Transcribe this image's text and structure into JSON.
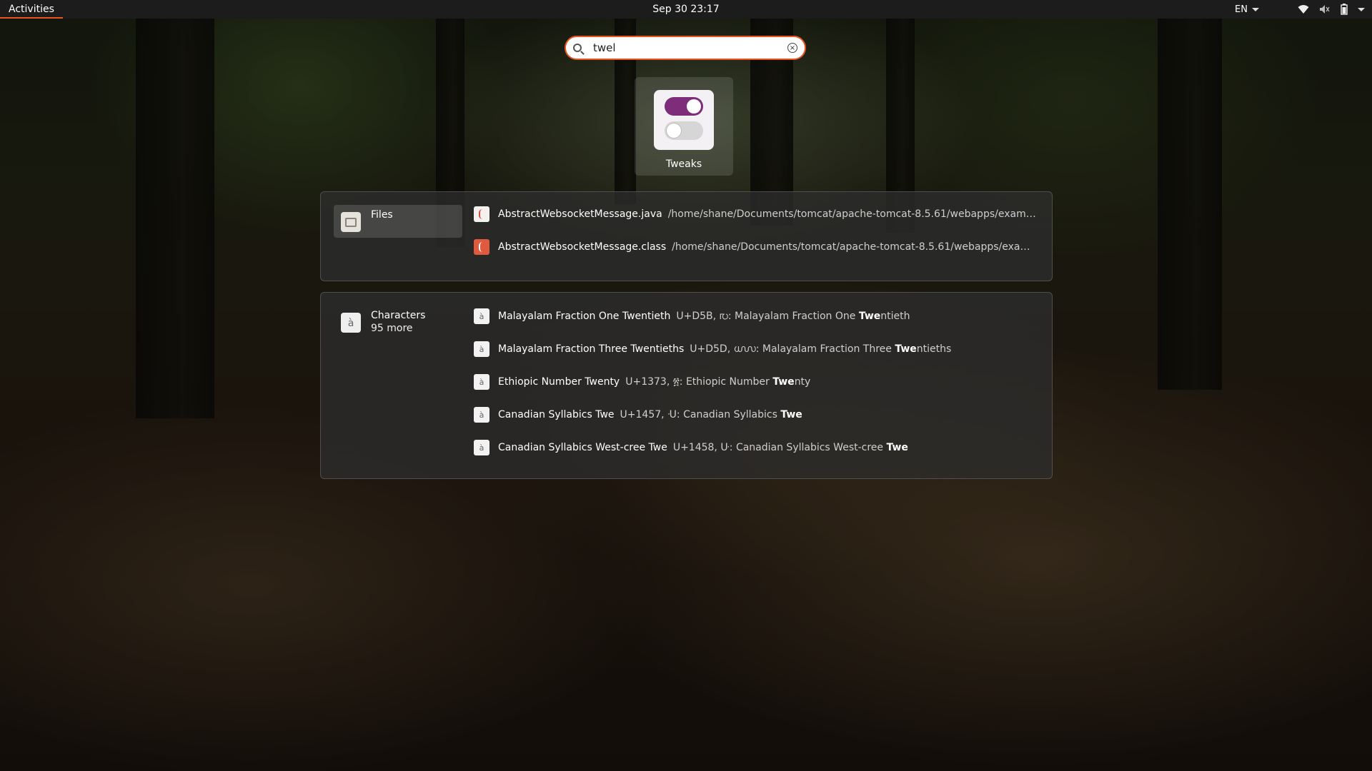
{
  "topbar": {
    "activities": "Activities",
    "clock": "Sep 30  23:17",
    "language": "EN"
  },
  "icons": {
    "wifi": "wifi-icon",
    "volume": "volume-icon",
    "battery": "battery-icon",
    "system_menu": "chevron-down-icon"
  },
  "search": {
    "value": "twel",
    "clear_symbol": "×"
  },
  "apps": [
    {
      "label": "Tweaks",
      "icon": "tweaks-toggle-icon"
    }
  ],
  "files": {
    "provider": "Files",
    "results": [
      {
        "name": "AbstractWebsocketMessage.java",
        "path": "/home/shane/Documents/tomcat/apache-tomcat-8.5.61/webapps/exampl…"
      },
      {
        "name": "AbstractWebsocketMessage.class",
        "path": "/home/shane/Documents/tomcat/apache-tomcat-8.5.61/webapps/examp…"
      }
    ]
  },
  "characters": {
    "provider": "Characters",
    "more": "95 more",
    "glyph": "à",
    "results": [
      {
        "name": "Malayalam Fraction One Twentieth",
        "desc_pre": "U+D5B, ൛: Malayalam Fraction One ",
        "desc_bold": "Twe",
        "desc_post": "ntieth"
      },
      {
        "name": "Malayalam Fraction Three Twentieths",
        "desc_pre": "U+D5D, ൝: Malayalam Fraction Three ",
        "desc_bold": "Twe",
        "desc_post": "ntieths"
      },
      {
        "name": "Ethiopic Number Twenty",
        "desc_pre": "U+1373, ፳: Ethiopic Number ",
        "desc_bold": "Twe",
        "desc_post": "nty"
      },
      {
        "name": "Canadian Syllabics Twe",
        "desc_pre": "U+1457, ᑗ: Canadian Syllabics ",
        "desc_bold": "Twe",
        "desc_post": ""
      },
      {
        "name": "Canadian Syllabics West-cree Twe",
        "desc_pre": "U+1458, ᑘ: Canadian Syllabics West-cree ",
        "desc_bold": "Twe",
        "desc_post": ""
      }
    ]
  },
  "colors": {
    "accent": "#e95420",
    "toggle_on": "#7d2d7a"
  }
}
